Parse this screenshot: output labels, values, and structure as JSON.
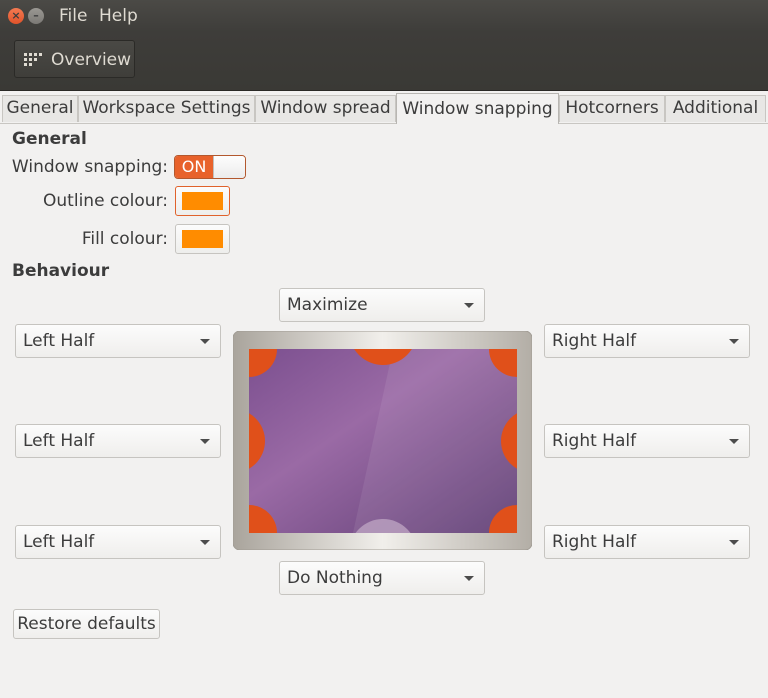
{
  "window": {
    "menu": [
      "File",
      "Help"
    ],
    "close_glyph": "×",
    "minimize_glyph": "–"
  },
  "toolbar": {
    "overview_label": "Overview",
    "overview_icon": "grid-icon"
  },
  "tabs": [
    "General",
    "Workspace Settings",
    "Window spread",
    "Window snapping",
    "Hotcorners",
    "Additional"
  ],
  "active_tab": "Window snapping",
  "general": {
    "heading": "General",
    "snapping_label": "Window snapping:",
    "snapping_state": "ON",
    "outline_label": "Outline colour:",
    "outline_color": "#ff8c00",
    "fill_label": "Fill colour:",
    "fill_color": "#ff8c00"
  },
  "behaviour": {
    "heading": "Behaviour",
    "top": "Maximize",
    "bottom": "Do Nothing",
    "left": [
      "Left Half",
      "Left Half",
      "Left Half"
    ],
    "right": [
      "Right Half",
      "Right Half",
      "Right Half"
    ]
  },
  "restore_label": "Restore defaults",
  "colors": {
    "accent": "#e8622b",
    "corner": "#e0501a",
    "screen": "#7b4f8c"
  }
}
